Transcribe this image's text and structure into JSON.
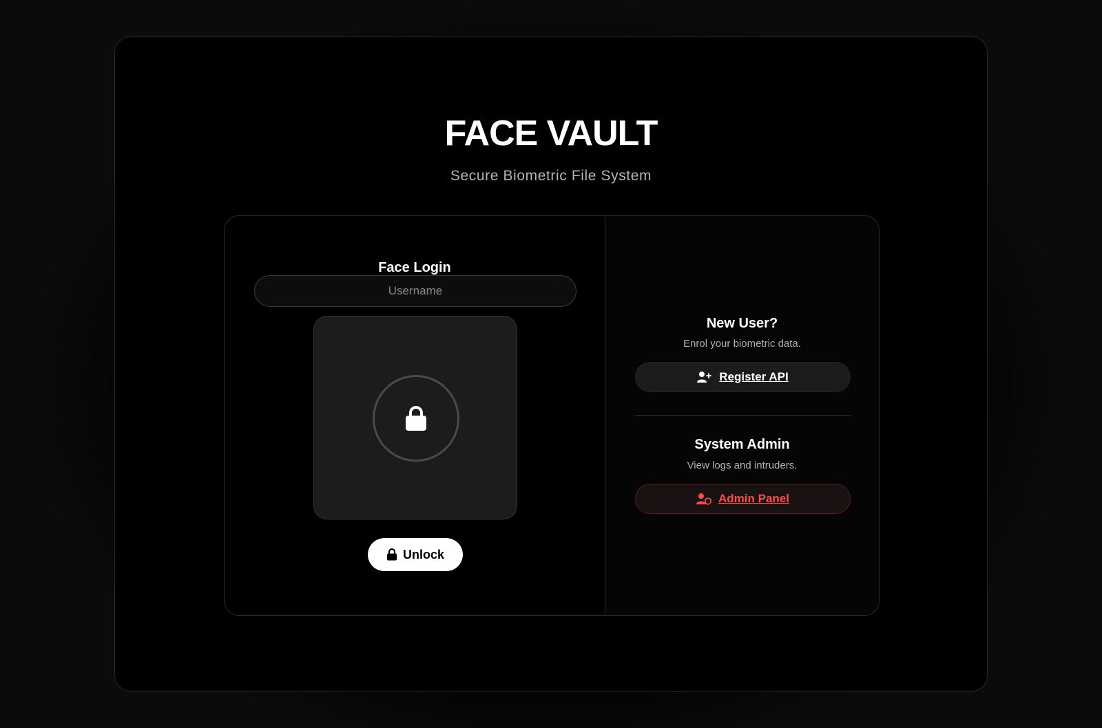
{
  "app": {
    "title": "FACE VAULT",
    "subtitle": "Secure Biometric File System"
  },
  "login": {
    "title": "Face Login",
    "username_placeholder": "Username",
    "username_value": "",
    "camera_icon": "lock-icon",
    "unlock_label": "Unlock",
    "unlock_icon": "lock-icon"
  },
  "register": {
    "title": "New User?",
    "description": "Enrol your biometric data.",
    "button_label": "Register API",
    "button_icon": "user-plus-icon"
  },
  "admin": {
    "title": "System Admin",
    "description": "View logs and intruders.",
    "button_label": "Admin Panel",
    "button_icon": "user-shield-icon",
    "accent_color": "#ff4d4d"
  }
}
